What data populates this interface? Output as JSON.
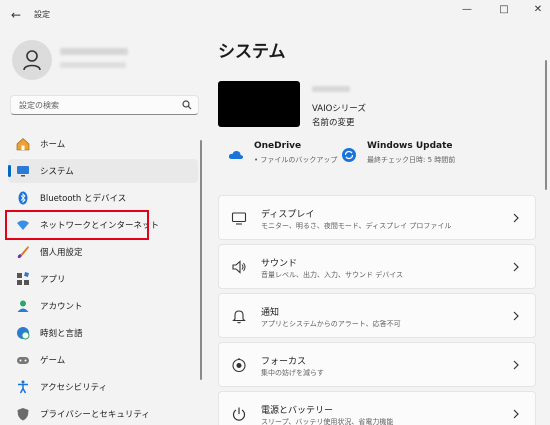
{
  "app": {
    "title": "設定"
  },
  "search": {
    "placeholder": "設定の検索"
  },
  "sidebar": {
    "items": [
      {
        "label": "ホーム",
        "icon": "home-icon"
      },
      {
        "label": "システム",
        "icon": "system-icon",
        "active": true
      },
      {
        "label": "Bluetooth とデバイス",
        "icon": "bluetooth-icon"
      },
      {
        "label": "ネットワークとインターネット",
        "icon": "wifi-icon",
        "highlighted": true
      },
      {
        "label": "個人用設定",
        "icon": "brush-icon"
      },
      {
        "label": "アプリ",
        "icon": "apps-icon"
      },
      {
        "label": "アカウント",
        "icon": "account-icon"
      },
      {
        "label": "時刻と言語",
        "icon": "globe-clock-icon"
      },
      {
        "label": "ゲーム",
        "icon": "gamepad-icon"
      },
      {
        "label": "アクセシビリティ",
        "icon": "accessibility-icon"
      },
      {
        "label": "プライバシーとセキュリティ",
        "icon": "shield-icon"
      }
    ]
  },
  "main": {
    "title": "システム",
    "device": {
      "model": "VAIOシリーズ",
      "rename": "名前の変更"
    },
    "quick": {
      "onedrive": {
        "title": "OneDrive",
        "subtitle": "• ファイルのバックアップ"
      },
      "update": {
        "title": "Windows Update",
        "subtitle": "最終チェック日時: 5 時間前"
      }
    },
    "cards": [
      {
        "title": "ディスプレイ",
        "subtitle": "モニター、明るさ、夜間モード、ディスプレイ プロファイル",
        "icon": "display-icon"
      },
      {
        "title": "サウンド",
        "subtitle": "音量レベル、出力、入力、サウンド デバイス",
        "icon": "speaker-icon"
      },
      {
        "title": "通知",
        "subtitle": "アプリとシステムからのアラート、応答不可",
        "icon": "bell-icon"
      },
      {
        "title": "フォーカス",
        "subtitle": "集中の妨げを減らす",
        "icon": "focus-icon"
      },
      {
        "title": "電源とバッテリー",
        "subtitle": "スリープ、バッテリ使用状況、省電力機能",
        "icon": "power-icon"
      }
    ]
  },
  "colors": {
    "accent": "#0067c0",
    "highlight": "#e3001b"
  }
}
